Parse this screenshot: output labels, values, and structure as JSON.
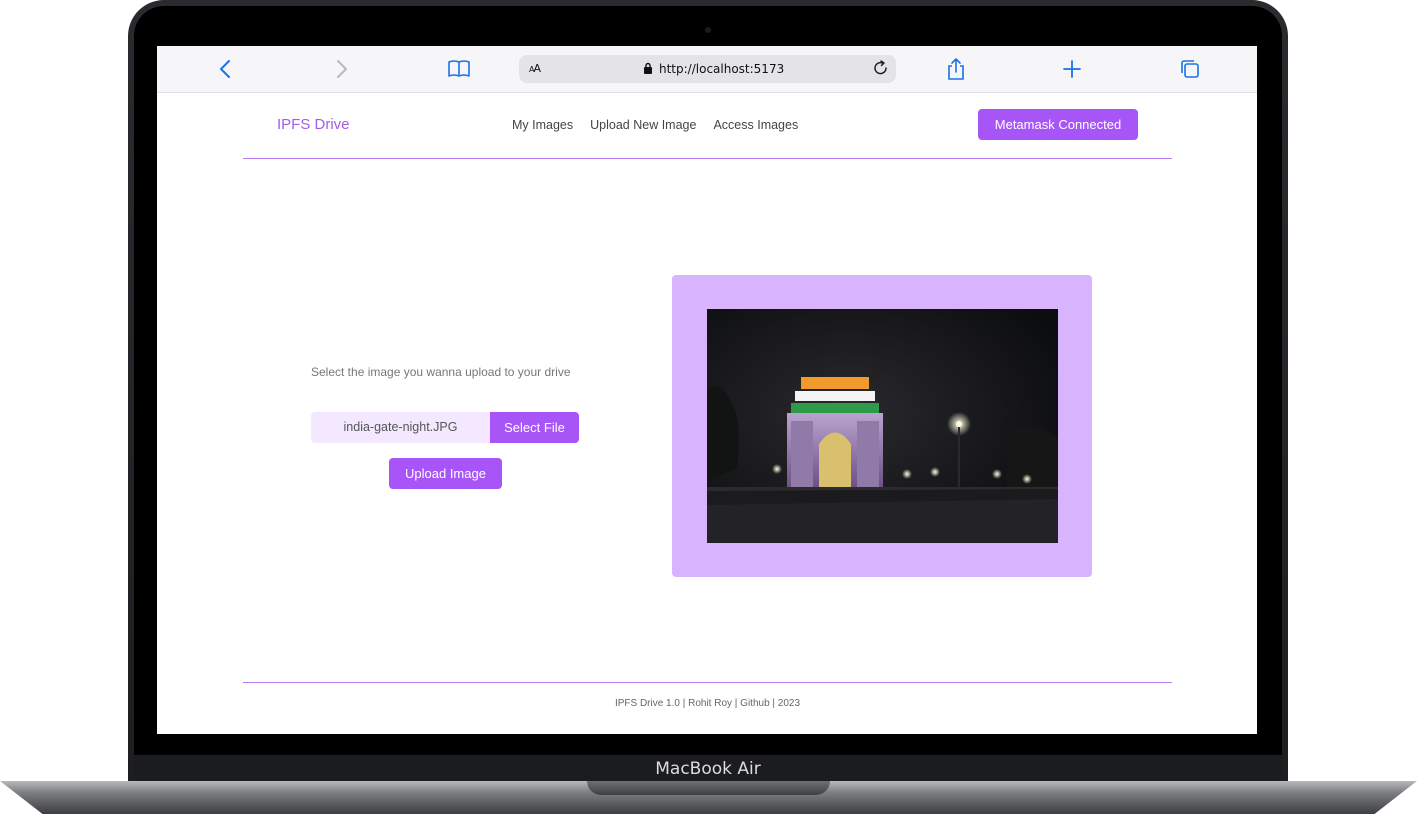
{
  "device": {
    "label": "MacBook Air"
  },
  "browser": {
    "text_size_label": "AA",
    "url": "http://localhost:5173"
  },
  "app": {
    "brand": "IPFS Drive",
    "nav": [
      "My Images",
      "Upload New Image",
      "Access Images"
    ],
    "wallet_button": "Metamask Connected"
  },
  "upload": {
    "prompt": "Select the image you wanna upload to your drive",
    "file_name": "india-gate-night.JPG",
    "select_button": "Select File",
    "upload_button": "Upload Image"
  },
  "footer": {
    "text": "IPFS Drive 1.0 | Rohit Roy | Github | 2023"
  },
  "colors": {
    "accent": "#a855f7",
    "preview_bg": "#d8b4fe",
    "file_bg": "#f3e8ff"
  }
}
